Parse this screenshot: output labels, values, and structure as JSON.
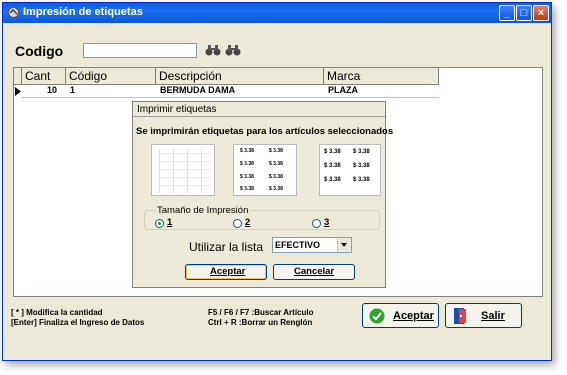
{
  "window": {
    "title": "Impresión de etiquetas",
    "controls": {
      "minimize": "_",
      "maximize": "□",
      "close": "×"
    }
  },
  "search": {
    "label": "Codigo",
    "value": "",
    "icons": [
      "binoculars-icon",
      "binoculars-icon"
    ]
  },
  "table": {
    "columns": [
      "Cant",
      "Código",
      "Descripción",
      "Marca"
    ],
    "rows": [
      {
        "cant": "10",
        "codigo": "1",
        "descripcion": "BERMUDA DAMA",
        "marca": "PLAZA"
      }
    ]
  },
  "dialog": {
    "title": "Imprimir etiquetas",
    "message": "Se imprimirán etiquetas para los artículos seleccionados",
    "label_price": "$ 3.38",
    "size_group": {
      "label": "Tamaño de Impresión",
      "options": [
        "1",
        "2",
        "3"
      ],
      "selected": "1"
    },
    "list": {
      "label": "Utilizar la lista",
      "value": "EFECTIVO"
    },
    "accept_label": "Aceptar",
    "cancel_label": "Cancelar"
  },
  "status": {
    "line1": "[ * ]  Modifica la cantidad",
    "line2": "[Enter]  Finaliza el Ingreso de Datos",
    "line3": "F5 / F6 / F7 :Buscar Artículo",
    "line4": "Ctrl + R :Borrar un Renglón"
  },
  "buttons": {
    "accept_label": "Aceptar",
    "exit_label": "Salir"
  },
  "colors": {
    "titlebar": "#0a5fe0",
    "window_bg": "#ece9d8",
    "accept_icon": "#2fa52f"
  }
}
